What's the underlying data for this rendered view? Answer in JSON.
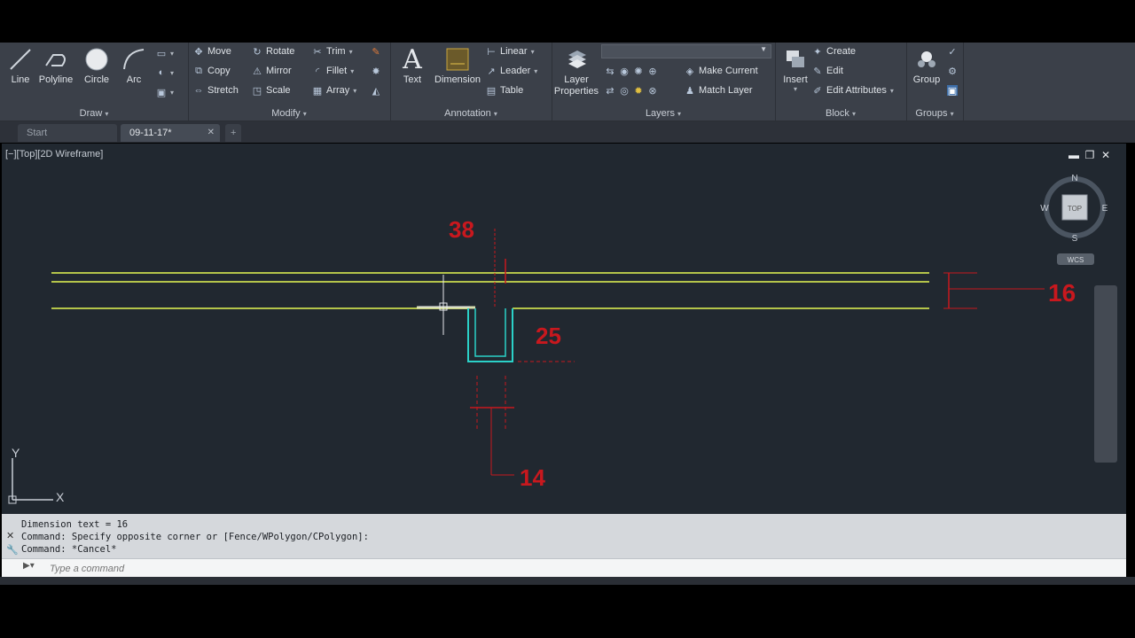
{
  "ribbon": {
    "draw": {
      "title": "Draw",
      "tools": [
        "Line",
        "Polyline",
        "Circle",
        "Arc"
      ]
    },
    "modify": {
      "title": "Modify",
      "tools": [
        "Move",
        "Rotate",
        "Trim",
        "Copy",
        "Mirror",
        "Fillet",
        "Stretch",
        "Scale",
        "Array"
      ]
    },
    "annotation": {
      "title": "Annotation",
      "text": "Text",
      "dimension": "Dimension",
      "linear": "Linear",
      "leader": "Leader",
      "table": "Table"
    },
    "layers": {
      "title": "Layers",
      "layer_properties": "Layer Properties",
      "make_current": "Make Current",
      "match_layer": "Match Layer"
    },
    "block": {
      "title": "Block",
      "insert": "Insert",
      "create": "Create",
      "edit": "Edit",
      "edit_attributes": "Edit Attributes"
    },
    "groups": {
      "title": "Groups",
      "group": "Group"
    }
  },
  "tabs": {
    "start": "Start",
    "drawing": "09-11-17*",
    "new": "+"
  },
  "viewport": {
    "label": "[−][Top][2D Wireframe]",
    "compass": {
      "n": "N",
      "s": "S",
      "e": "E",
      "w": "W",
      "top": "TOP",
      "wcs": "WCS"
    },
    "ucs": {
      "x": "X",
      "y": "Y"
    },
    "dimensions": {
      "d38": "38",
      "d16": "16",
      "d25": "25",
      "d14": "14"
    },
    "colors": {
      "background": "#212830",
      "lines": "#b4c44a",
      "slot": "#2bd1c8",
      "dims": "#c8181e"
    }
  },
  "command": {
    "history": [
      "Dimension text = 16",
      "Command: Specify opposite corner or [Fence/WPolygon/CPolygon]:",
      "Command: *Cancel*"
    ],
    "placeholder": "Type a command"
  }
}
